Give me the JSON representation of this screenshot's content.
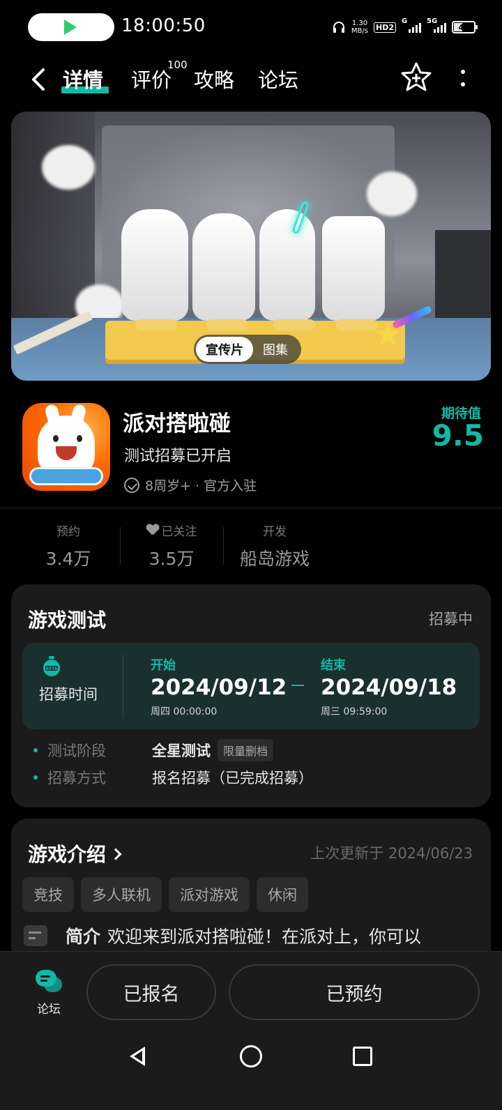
{
  "status_bar": {
    "time": "18:00:50",
    "net_speed_top": "1.30",
    "net_speed_unit": "MB/s",
    "hd_label": "HD2",
    "signal_1": "G",
    "signal_2": "5G",
    "battery": "41"
  },
  "nav": {
    "tabs": [
      {
        "label": "详情",
        "active": true
      },
      {
        "label": "评价",
        "badge": "100"
      },
      {
        "label": "攻略"
      },
      {
        "label": "论坛"
      }
    ]
  },
  "banner": {
    "toggle_on": "宣传片",
    "toggle_off": "图集"
  },
  "game": {
    "title": "派对搭啦碰",
    "subtitle": "测试招募已开启",
    "meta": "8周岁+ · 官方入驻",
    "expect_label": "期待值",
    "expect_value": "9.5"
  },
  "stats": [
    {
      "label": "预约",
      "value": "3.4万"
    },
    {
      "label": "已关注",
      "value": "3.5万"
    },
    {
      "label": "开发",
      "value": "船岛游戏"
    }
  ],
  "test_card": {
    "title": "游戏测试",
    "status": "招募中",
    "time_label": "招募时间",
    "start_head": "开始",
    "start_date": "2024/09/12",
    "start_sub": "周四   00:00:00",
    "end_head": "结束",
    "end_date": "2024/09/18",
    "end_sub": "周三   09:59:00",
    "rows": [
      {
        "key": "测试阶段",
        "value": "全星测试",
        "tag": "限量删档"
      },
      {
        "key": "招募方式",
        "value": "报名招募（已完成招募）"
      }
    ]
  },
  "intro_card": {
    "title": "游戏介绍",
    "updated": "上次更新于 2024/06/23",
    "tags": [
      "竞技",
      "多人联机",
      "派对游戏",
      "休闲"
    ],
    "intro_label": "简介",
    "intro_text": "欢迎来到派对搭啦碰！在派对上，你可以"
  },
  "bottom_bar": {
    "forum_label": "论坛",
    "signed_up": "已报名",
    "reserved": "已预约"
  },
  "colors": {
    "accent": "#14b8a6",
    "background": "#000000",
    "card": "#1b1b1b"
  }
}
